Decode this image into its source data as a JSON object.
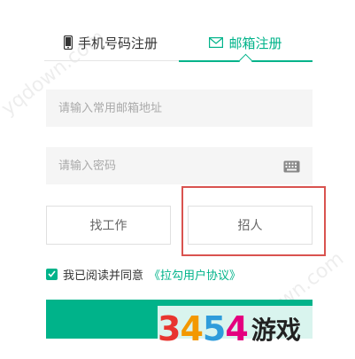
{
  "tabs": [
    {
      "label": "手机号码注册",
      "icon": "mobile-phone-icon",
      "active": false
    },
    {
      "label": "邮箱注册",
      "icon": "envelope-icon",
      "active": true
    }
  ],
  "form": {
    "email_placeholder": "请输入常用邮箱地址",
    "password_placeholder": "请输入密码"
  },
  "roles": {
    "job_label": "找工作",
    "hire_label": "招人"
  },
  "agreement": {
    "text": "我已阅读并同意",
    "link": "《拉勾用户协议》",
    "checked": true
  },
  "watermark": {
    "domain": "yqdown.com",
    "brand_number": "3454",
    "brand_text": "游戏"
  },
  "colors": {
    "accent": "#00b38a",
    "highlight": "#d9534f"
  }
}
